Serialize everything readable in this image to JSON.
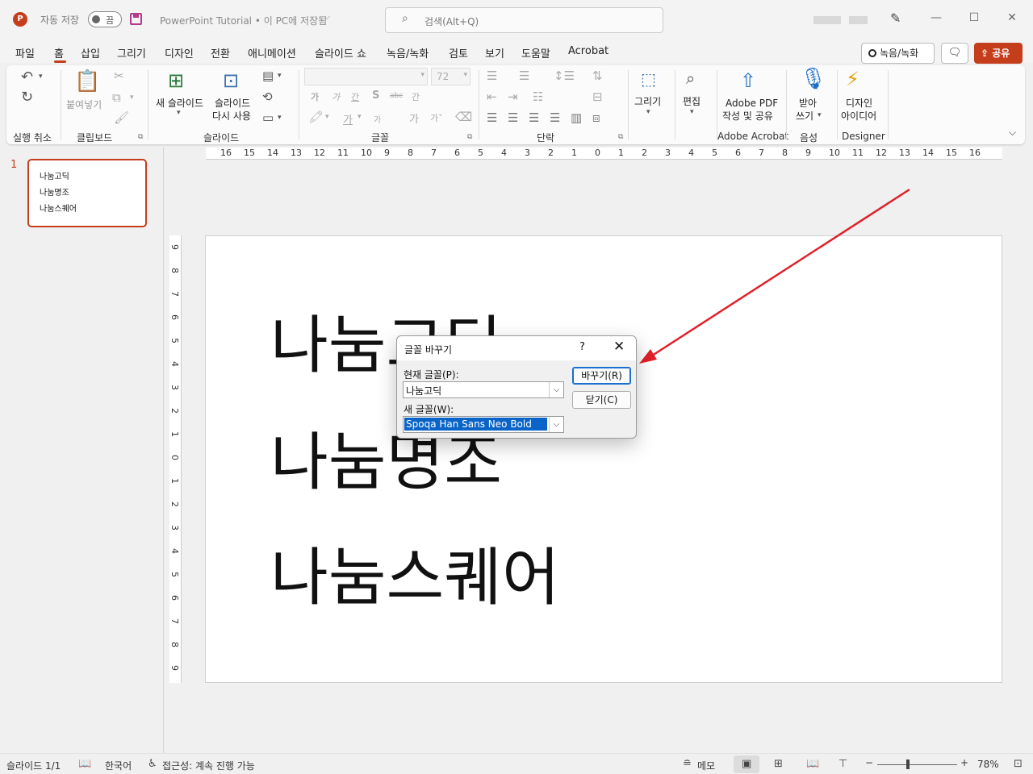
{
  "titlebar": {
    "app_logo": "P",
    "autosave_label": "자동 저장",
    "autosave_state": "끔",
    "doc_title": "PowerPoint Tutorial • 이 PC에 저장됨",
    "search_placeholder": "검색(Alt+Q)"
  },
  "tabs": [
    "파일",
    "홈",
    "삽입",
    "그리기",
    "디자인",
    "전환",
    "애니메이션",
    "슬라이드 쇼",
    "녹음/녹화",
    "검토",
    "보기",
    "도움말",
    "Acrobat"
  ],
  "active_tab": "홈",
  "top_buttons": {
    "record": "녹음/녹화",
    "share": "공유"
  },
  "ribbon": {
    "groups": {
      "undo": "실행 취소",
      "clipboard": "클립보드",
      "slides": "슬라이드",
      "font": "글꼴",
      "paragraph": "단락",
      "adobe": "Adobe Acrobat",
      "voice": "음성",
      "designer": "Designer"
    },
    "paste": "붙여넣기",
    "new_slide": "새 슬라이드",
    "reuse_slide_1": "슬라이드",
    "reuse_slide_2": "다시 사용",
    "font_size": "72",
    "draw": "그리기",
    "edit": "편집",
    "adobe_pdf_1": "Adobe PDF",
    "adobe_pdf_2": "작성 및 공유",
    "dictate_1": "받아",
    "dictate_2": "쓰기",
    "designer_1": "디자인",
    "designer_2": "아이디어",
    "font_row2": [
      "가",
      "가",
      "간",
      "S",
      "abc",
      "간"
    ],
    "font_row3": [
      "가",
      "가",
      "가"
    ]
  },
  "thumbnails": {
    "slide_number": "1",
    "lines": [
      "나눔고딕",
      "나눔명조",
      "나눔스퀘어"
    ]
  },
  "hruler_ticks": [
    "16",
    "15",
    "14",
    "13",
    "12",
    "11",
    "10",
    "9",
    "8",
    "7",
    "6",
    "5",
    "4",
    "3",
    "2",
    "1",
    "0",
    "1",
    "2",
    "3",
    "4",
    "5",
    "6",
    "7",
    "8",
    "9",
    "10",
    "11",
    "12",
    "13",
    "14",
    "15",
    "16"
  ],
  "vruler_ticks": [
    "9",
    "8",
    "7",
    "6",
    "5",
    "4",
    "3",
    "2",
    "1",
    "0",
    "1",
    "2",
    "3",
    "4",
    "5",
    "6",
    "7",
    "8",
    "9"
  ],
  "slide": {
    "lines": [
      "나눔고딕",
      "나눔명조",
      "나눔스퀘어"
    ]
  },
  "dialog": {
    "title": "글꼴 바꾸기",
    "help": "?",
    "current_font_label": "현재 글꼴(P):",
    "current_font_value": "나눔고딕",
    "new_font_label": "새 글꼴(W):",
    "new_font_value": "Spoqa Han Sans Neo Bold",
    "replace_button": "바꾸기(R)",
    "close_button": "닫기(C)"
  },
  "statusbar": {
    "slide_info": "슬라이드 1/1",
    "language": "한국어",
    "accessibility": "접근성: 계속 진행 가능",
    "notes": "메모",
    "zoom": "78%"
  },
  "colors": {
    "accent": "#c43e1c",
    "arrow": "#e0202a",
    "selection": "#0a64c8"
  }
}
